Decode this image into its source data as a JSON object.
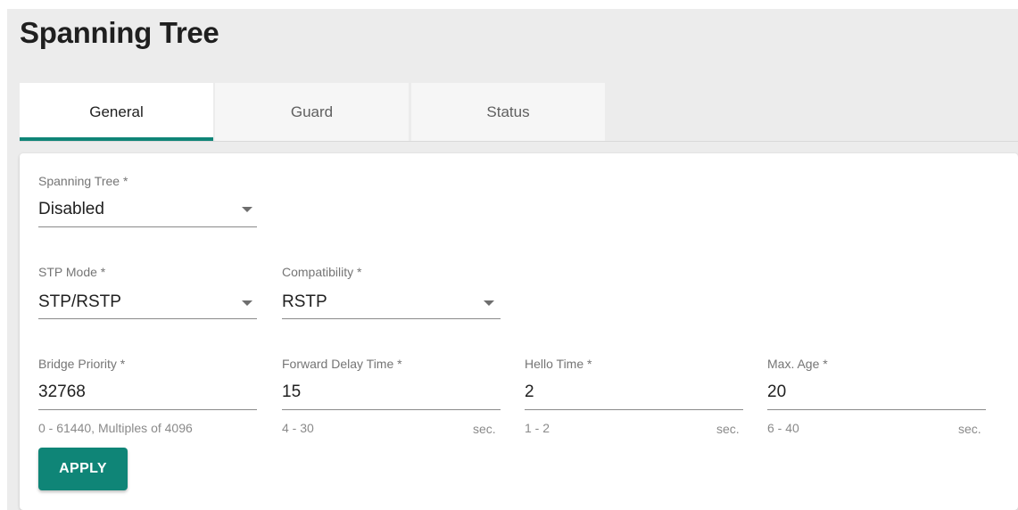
{
  "page": {
    "title": "Spanning Tree"
  },
  "tabs": [
    {
      "label": "General",
      "active": true
    },
    {
      "label": "Guard",
      "active": false
    },
    {
      "label": "Status",
      "active": false
    }
  ],
  "form": {
    "spanning_tree": {
      "label": "Spanning Tree *",
      "value": "Disabled"
    },
    "stp_mode": {
      "label": "STP Mode *",
      "value": "STP/RSTP"
    },
    "compatibility": {
      "label": "Compatibility *",
      "value": "RSTP"
    },
    "bridge_priority": {
      "label": "Bridge Priority *",
      "value": "32768",
      "hint": "0 - 61440, Multiples of 4096"
    },
    "forward_delay_time": {
      "label": "Forward Delay Time *",
      "value": "15",
      "hint": "4 - 30",
      "unit": "sec."
    },
    "hello_time": {
      "label": "Hello Time *",
      "value": "2",
      "hint": "1 - 2",
      "unit": "sec."
    },
    "max_age": {
      "label": "Max. Age *",
      "value": "20",
      "hint": "6 - 40",
      "unit": "sec."
    }
  },
  "actions": {
    "apply_label": "APPLY"
  },
  "colors": {
    "accent": "#0f8577",
    "background": "#ececec"
  }
}
